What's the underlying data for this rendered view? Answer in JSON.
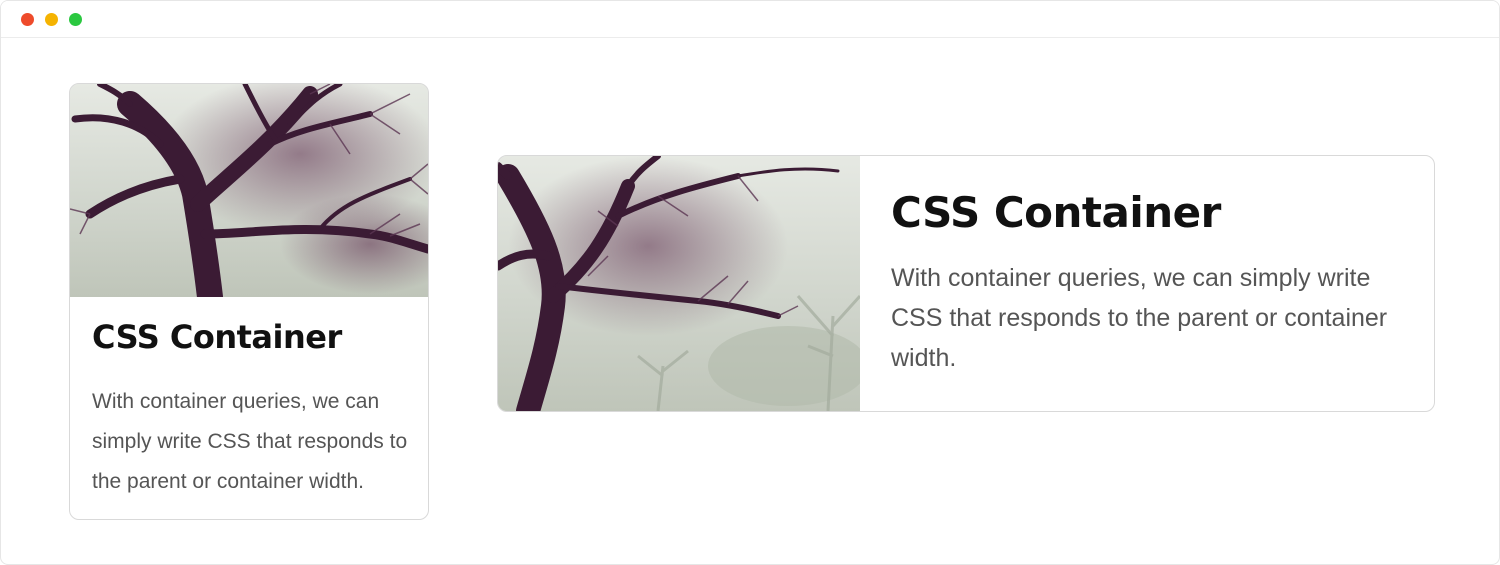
{
  "window": {
    "controls": [
      "close",
      "minimize",
      "maximize"
    ]
  },
  "cards": [
    {
      "variant": "stacked",
      "image": "misty-tree-photo",
      "title": "CSS Container",
      "description": "With container queries, we can simply write CSS that responds to the parent or container width."
    },
    {
      "variant": "horizontal",
      "image": "misty-tree-photo",
      "title": "CSS Container",
      "description": "With container queries, we can simply write CSS that responds to the parent or container width."
    }
  ]
}
